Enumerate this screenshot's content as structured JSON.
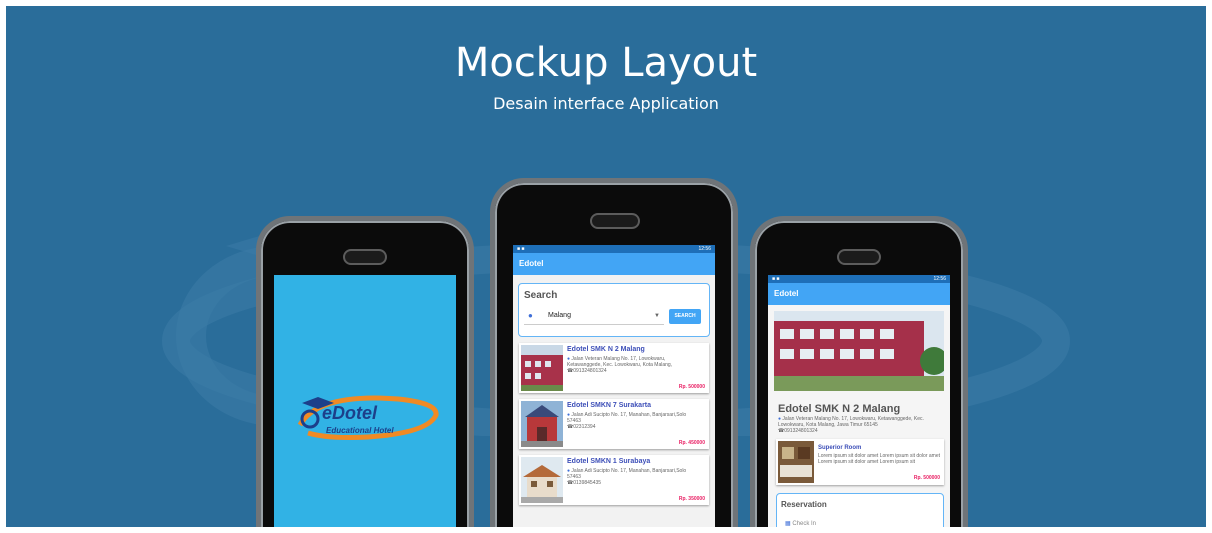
{
  "slide": {
    "title": "Mockup Layout",
    "subtitle": "Desain interface Application"
  },
  "colors": {
    "background": "#2a6d9a",
    "accent": "#42a5f5",
    "status_bar": "#1e6fb8",
    "splash": "#31b2e5",
    "price": "#e91e63"
  },
  "phone_splash": {
    "logo_text": "eDotel",
    "logo_tagline": "Educational Hotel"
  },
  "phone_search": {
    "status_time": "12:56",
    "app_title": "Edotel",
    "search": {
      "title": "Search",
      "location_value": "Malang",
      "button_label": "SEARCH"
    },
    "hotels": [
      {
        "name": "Edotel SMK N 2 Malang",
        "address": "Jalan Veteran Malang No. 17, Lowokwaru, Ketawanggede, Kec. Lowokwaru, Kota Malang,",
        "phone": "091324801324",
        "price": "Rp. 500000"
      },
      {
        "name": "Edotel SMKN 7 Surakarta",
        "address": "Jalan Adi Sucipto No. 17, Manahan, Banjarsari,Solo 57463",
        "phone": "02312394",
        "price": "Rp. 450000"
      },
      {
        "name": "Edotel SMKN 1 Surabaya",
        "address": "Jalan Adi Sucipto No. 17, Manahan, Banjarsari,Solo 57463",
        "phone": "0139845435",
        "price": "Rp. 350000"
      }
    ]
  },
  "phone_detail": {
    "status_time": "12:56",
    "app_title": "Edotel",
    "hotel_name": "Edotel SMK N 2 Malang",
    "hotel_address": "Jalan Veteran Malang No. 17, Lowokwaru, Ketawanggede, Kec. Lowokwaru, Kota Malang, Jawa Timur 65145",
    "hotel_phone": "091324801324",
    "room": {
      "title": "Superior Room",
      "description": "Lorem ipsum sit dolor amet Lorem ipsum sit dolor amet Lorem ipsum sit dolor amet Lorem ipsum sit",
      "price": "Rp. 500000"
    },
    "reservation": {
      "title": "Reservation",
      "checkin_placeholder": "Check In"
    }
  }
}
